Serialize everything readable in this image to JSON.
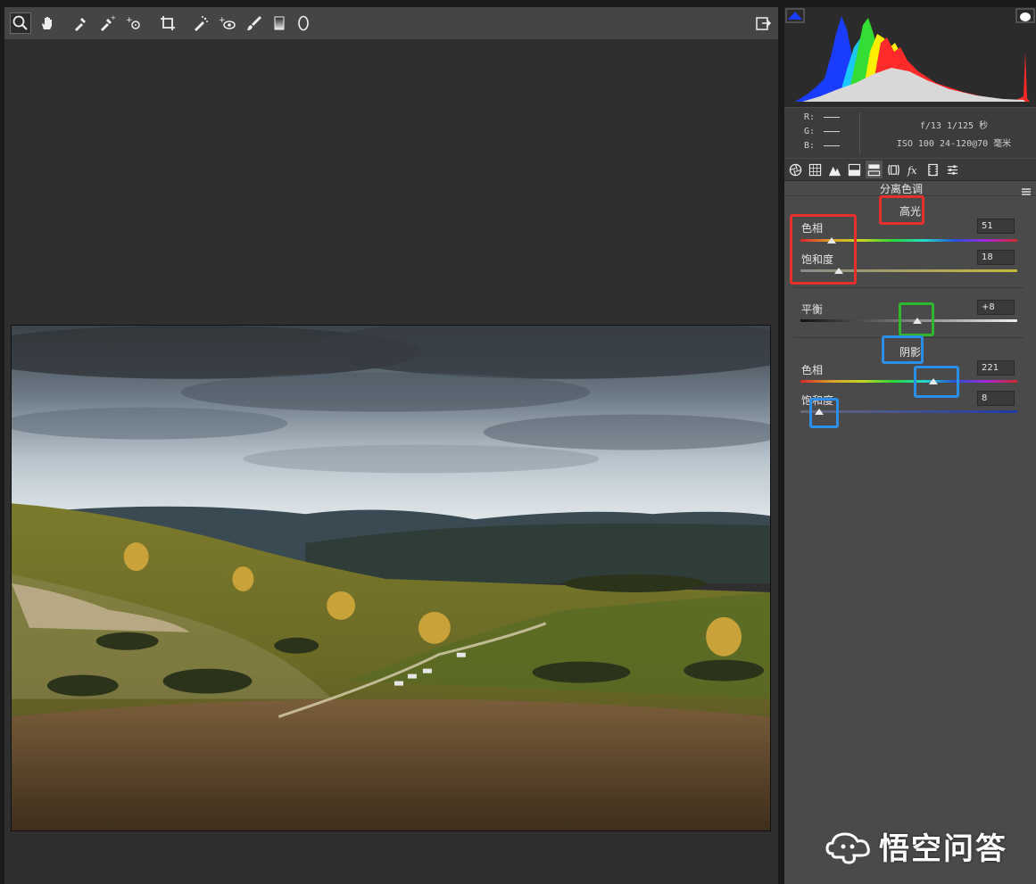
{
  "toolbar": {
    "tools": [
      "zoom-icon",
      "hand-icon",
      "white-balance-icon",
      "color-sampler-icon",
      "target-adjust-icon",
      "crop-icon",
      "spot-removal-icon",
      "red-eye-icon",
      "adjustment-brush-icon",
      "graduated-filter-icon",
      "radial-filter-icon"
    ],
    "export_icon": "open-preferences-icon"
  },
  "info": {
    "r_label": "R:",
    "g_label": "G:",
    "b_label": "B:",
    "aperture_shutter": "f/13  1/125 秒",
    "iso_lens": "ISO 100  24-120@70 毫米"
  },
  "panel": {
    "title": "分离色调",
    "highlights": {
      "heading": "高光",
      "hue_label": "色相",
      "hue_value": "51",
      "saturation_label": "饱和度",
      "saturation_value": "18"
    },
    "balance": {
      "label": "平衡",
      "value": "+8"
    },
    "shadows": {
      "heading": "阴影",
      "hue_label": "色相",
      "hue_value": "221",
      "saturation_label": "饱和度",
      "saturation_value": "8"
    }
  },
  "watermark": {
    "text": "悟空问答"
  },
  "colors": {
    "annotation_red": "#e8302a",
    "annotation_green": "#2eb82e",
    "annotation_blue": "#2b8fe8"
  }
}
